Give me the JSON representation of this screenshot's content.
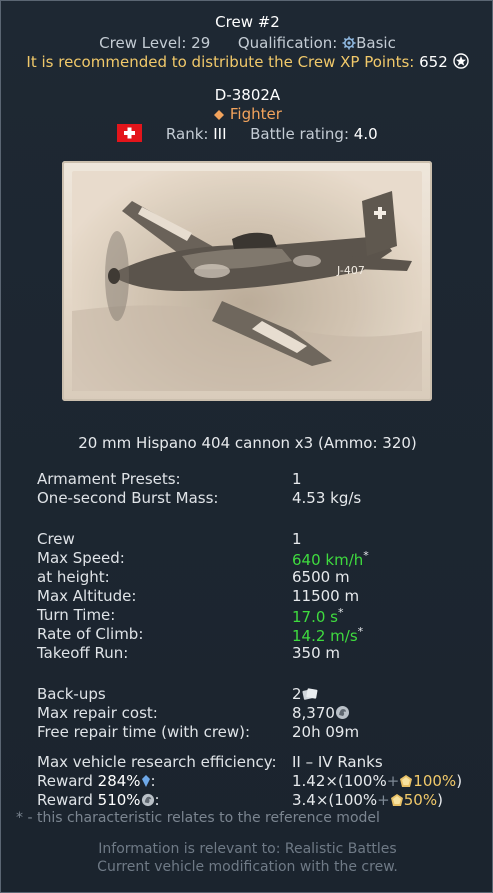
{
  "crew": {
    "title": "Crew #2",
    "level_label": "Crew Level:",
    "level_value": "29",
    "qualification_label": "Qualification:",
    "qualification_value": "Basic",
    "recommend_text": "It is recommended to distribute the Crew XP Points:",
    "xp_points": "652"
  },
  "vehicle": {
    "name": "D-3802A",
    "class": "Fighter",
    "rank_label": "Rank:",
    "rank_value": "III",
    "br_label": "Battle rating:",
    "br_value": "4.0",
    "country_flag": "switzerland-flag",
    "photo_caption": "J-407"
  },
  "weapon_line": "20 mm Hispano 404 cannon x3 (Ammo: 320)",
  "stats_armament": [
    {
      "label": "Armament Presets:",
      "value": "1"
    },
    {
      "label": "One-second Burst Mass:",
      "value": "4.53 kg/s"
    }
  ],
  "stats_flight": [
    {
      "label": "Crew",
      "value": "1",
      "star": ""
    },
    {
      "label": "Max Speed:",
      "value": "640 km/h",
      "star": "*"
    },
    {
      "label": "at height:",
      "value": "6500 m",
      "star": ""
    },
    {
      "label": "Max Altitude:",
      "value": "11500 m",
      "star": ""
    },
    {
      "label": "Turn Time:",
      "value": "17.0 s",
      "star": "*"
    },
    {
      "label": "Rate of Climb:",
      "value": "14.2 m/s",
      "star": "*"
    },
    {
      "label": "Takeoff Run:",
      "value": "350 m",
      "star": ""
    }
  ],
  "stats_economy": {
    "backups_label": "Back-ups",
    "backups_value": "2",
    "repair_cost_label": "Max repair cost:",
    "repair_cost_value": "8,370",
    "free_repair_label": "Free repair time (with crew):",
    "free_repair_value": "20h 09m"
  },
  "research": {
    "label": "Max vehicle research efficiency:",
    "value": "II – IV Ranks",
    "reward_rp_label": "Reward",
    "reward_rp_pct": "284%",
    "reward_rp_mult": "1.42",
    "reward_rp_paren_open": "×(100%",
    "reward_rp_plus": "+",
    "reward_rp_bonus": "100%",
    "reward_rp_close": ")",
    "reward_sl_label": "Reward",
    "reward_sl_pct": "510%",
    "reward_sl_mult": "3.4",
    "reward_sl_paren_open": "×(100%",
    "reward_sl_plus": "+",
    "reward_sl_bonus": "50%",
    "reward_sl_close": ")",
    "colon": ":"
  },
  "footnote": "* - this characteristic relates to the reference model",
  "info_line1": "Information is relevant to: Realistic Battles",
  "info_line2": "Current vehicle modification with the crew.",
  "colors": {
    "green": "#3fdb3f",
    "gold": "#f1c96a",
    "orange": "#f2a35c",
    "background": "#1c2530"
  }
}
